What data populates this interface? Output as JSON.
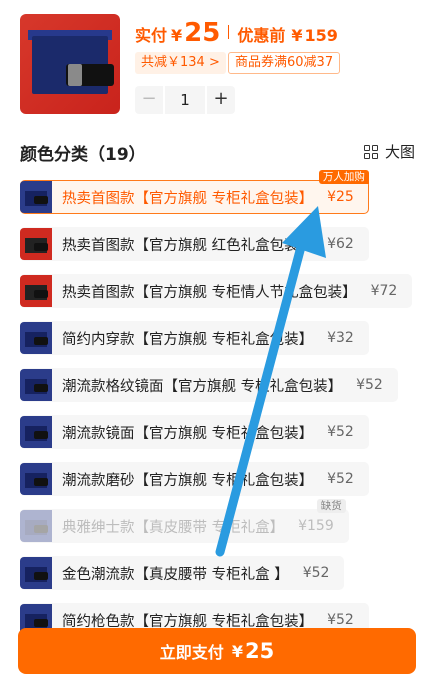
{
  "product": {
    "price_label": "实付",
    "price_currency": "¥",
    "price_value": "25",
    "original_label": "优惠前",
    "original_currency": "¥",
    "original_value": "159",
    "save_tag": "共减￥134 >",
    "coupon_tag": "商品券满60减37",
    "quantity": "1",
    "minus_label": "−",
    "plus_label": "+"
  },
  "section": {
    "title": "颜色分类（19）",
    "big_view_label": "大图"
  },
  "variants": [
    {
      "name": "热卖首图款【官方旗舰 专柜礼盒包装】",
      "price": "¥25",
      "badge": "万人加购",
      "state": "selected",
      "thumb": "navy"
    },
    {
      "name": "热卖首图款【官方旗舰 红色礼盒包装】",
      "price": "¥62",
      "state": "normal",
      "thumb": "red"
    },
    {
      "name": "热卖首图款【官方旗舰 专柜情人节礼盒包装】",
      "price": "¥72",
      "state": "normal",
      "thumb": "red"
    },
    {
      "name": "简约内穿款【官方旗舰 专柜礼盒包装】",
      "price": "¥32",
      "state": "normal",
      "thumb": "navy"
    },
    {
      "name": "潮流款格纹镜面【官方旗舰 专柜礼盒包装】",
      "price": "¥52",
      "state": "normal",
      "thumb": "navy"
    },
    {
      "name": "潮流款镜面【官方旗舰 专柜礼盒包装】",
      "price": "¥52",
      "state": "normal",
      "thumb": "navy"
    },
    {
      "name": "潮流款磨砂【官方旗舰 专柜礼盒包装】",
      "price": "¥52",
      "state": "normal",
      "thumb": "navy"
    },
    {
      "name": "典雅绅士款【真皮腰带 专柜礼盒】",
      "price": "¥159",
      "badge": "缺货",
      "state": "disabled",
      "thumb": "navy"
    },
    {
      "name": "金色潮流款【真皮腰带 专柜礼盒 】",
      "price": "¥52",
      "state": "normal",
      "thumb": "navy"
    },
    {
      "name": "简约枪色款【官方旗舰 专柜礼盒包装】",
      "price": "¥52",
      "state": "normal",
      "thumb": "navy"
    }
  ],
  "footer": {
    "pay_label": "立即支付",
    "pay_currency": "¥",
    "pay_value": "25"
  },
  "colors": {
    "accent": "#ff6a00",
    "price": "#ff5a00",
    "arrow": "#2a9be0"
  }
}
